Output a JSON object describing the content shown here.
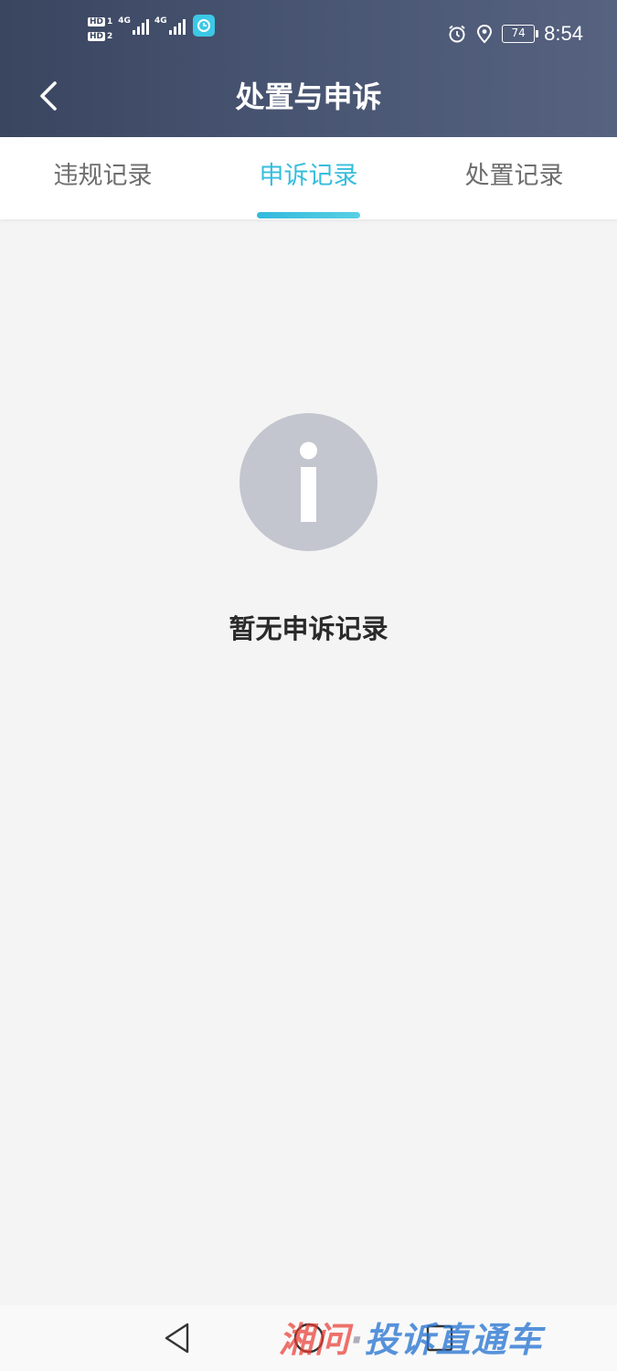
{
  "status_bar": {
    "hd1": "HD",
    "hd1_index": "1",
    "hd2": "HD",
    "hd2_index": "2",
    "network1": "4G",
    "network2": "4G",
    "battery_level": "74",
    "time": "8:54"
  },
  "header": {
    "title": "处置与申诉"
  },
  "tabs": [
    {
      "label": "违规记录",
      "active": false
    },
    {
      "label": "申诉记录",
      "active": true
    },
    {
      "label": "处置记录",
      "active": false
    }
  ],
  "empty_state": {
    "icon": "info-icon",
    "message": "暂无申诉记录"
  },
  "watermark": {
    "part1": "湘问",
    "dot": "·",
    "part2": "投诉直通车"
  },
  "colors": {
    "header_start": "#3a4560",
    "header_end": "#56627f",
    "accent": "#36bedc",
    "tab_inactive": "#6e6e6e",
    "background": "#f4f4f4",
    "empty_icon": "#c3c6cf"
  }
}
